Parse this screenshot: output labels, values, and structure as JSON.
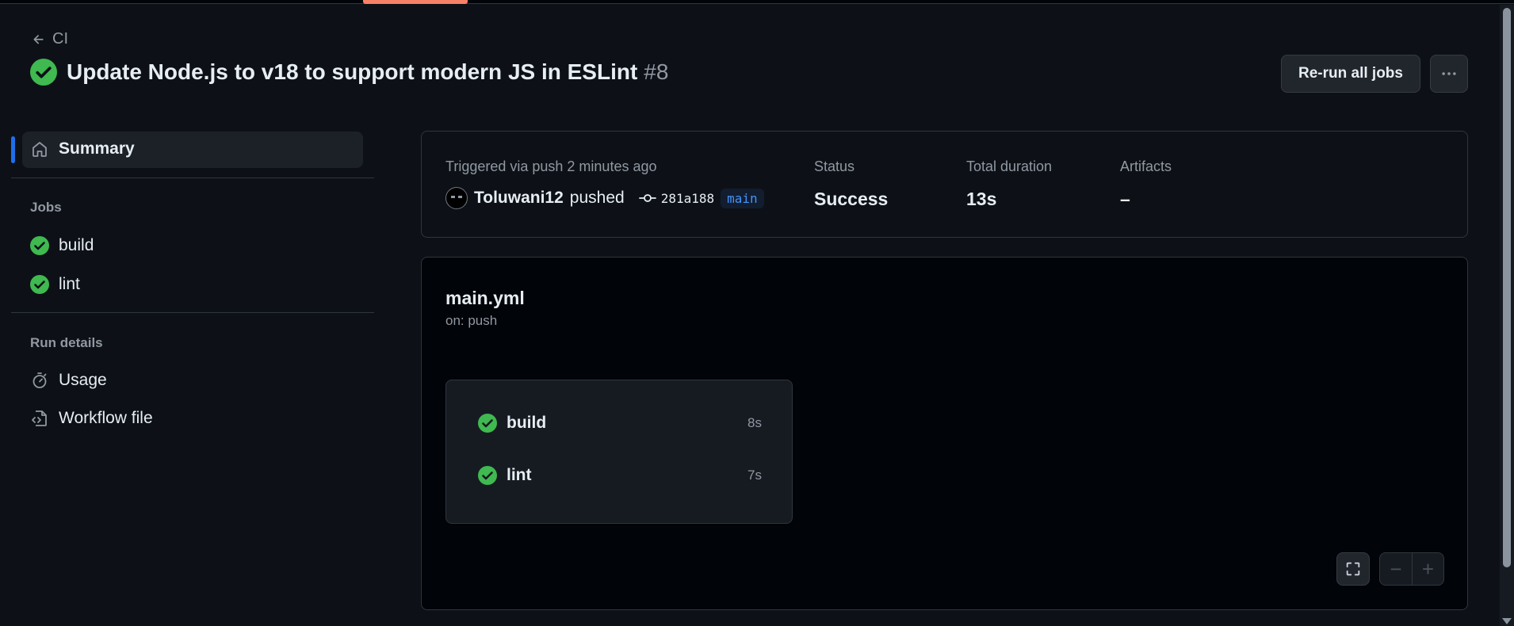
{
  "header": {
    "back_label": "CI",
    "title": "Update Node.js to v18 to support modern JS in ESLint",
    "run_number": "#8",
    "rerun_label": "Re-run all jobs"
  },
  "sidebar": {
    "summary_label": "Summary",
    "jobs_heading": "Jobs",
    "jobs": [
      {
        "label": "build"
      },
      {
        "label": "lint"
      }
    ],
    "run_details_heading": "Run details",
    "usage_label": "Usage",
    "workflow_file_label": "Workflow file"
  },
  "summary": {
    "trigger_text": "Triggered via push 2 minutes ago",
    "user": "Toluwani12",
    "action": "pushed",
    "commit": "281a188",
    "branch": "main",
    "status_label": "Status",
    "status_value": "Success",
    "duration_label": "Total duration",
    "duration_value": "13s",
    "artifacts_label": "Artifacts",
    "artifacts_value": "–"
  },
  "workflow": {
    "name": "main.yml",
    "on": "on: push",
    "jobs": [
      {
        "label": "build",
        "duration": "8s"
      },
      {
        "label": "lint",
        "duration": "7s"
      }
    ],
    "zoom_out": "−",
    "zoom_in": "+"
  },
  "colors": {
    "success": "#3fb950",
    "accent": "#1f6feb",
    "background": "#0d1117"
  }
}
